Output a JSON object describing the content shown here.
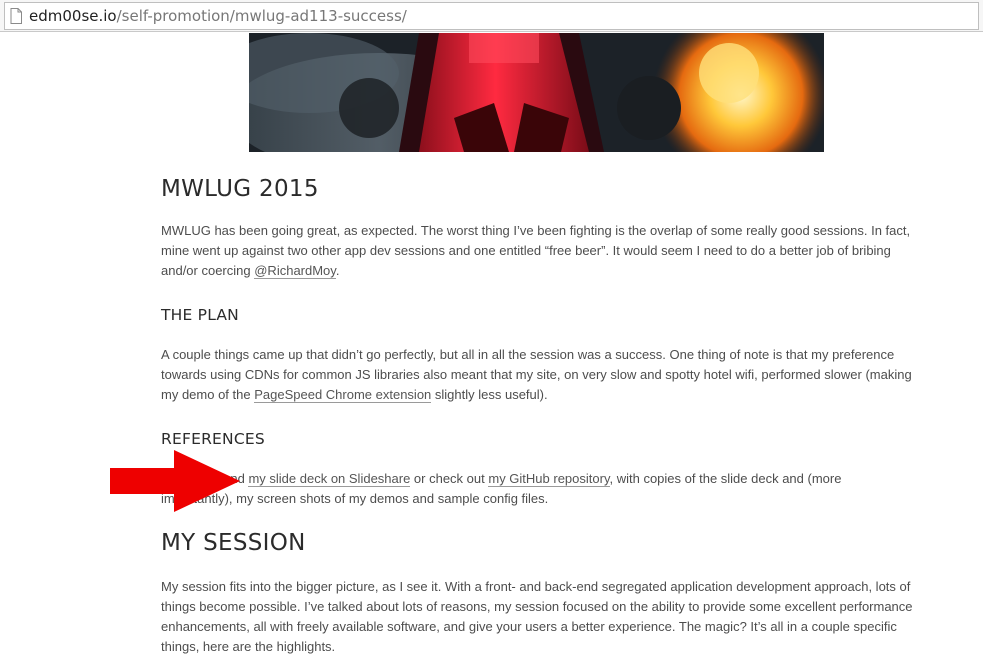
{
  "browser": {
    "url_host": "edm00se.io",
    "url_path": "/self-promotion/mwlug-ad113-success/"
  },
  "article": {
    "heading_1": "MWLUG 2015",
    "para_1_text": "MWLUG has been going great, as expected. The worst thing I’ve been fighting is the overlap of some really good sessions. In fact, mine went up against two other app dev sessions and one entitled “free beer”. It would seem I need to do a better job of bribing and/or coercing ",
    "para_1_link": "@RichardMoy",
    "para_1_end": ".",
    "heading_2": "THE PLAN",
    "para_2_text": "A couple things came up that didn’t go perfectly, but all in all the session was a success. One thing of note is that my preference towards using CDNs for common JS libraries also meant that my site, on very slow and spotty hotel wifi, performed slower (making my demo of the ",
    "para_2_link": "PageSpeed Chrome extension",
    "para_2_end": " slightly less useful).",
    "heading_3": "REFERENCES",
    "para_3_start": "Check out and ",
    "para_3_link_1": "my slide deck on Slideshare",
    "para_3_mid": " or check out ",
    "para_3_link_2": "my GitHub repository",
    "para_3_end": ", with copies of the slide deck and (more importantly), my screen shots of my demos and sample config files.",
    "heading_4": "MY SESSION",
    "para_4_text": "My session fits into the bigger picture, as I see it. With a front- and back-end segregated application development approach, lots of things become possible. I’ve talked about lots of reasons, my session focused on the ability to provide some excellent performance enhancements, all with freely available software, and give your users a better experience. The magic? It’s all in a couple specific things, here are the highlights."
  },
  "colors": {
    "arrow": "#ee0000",
    "text": "#4d4d4d",
    "heading": "#2b2b2b"
  },
  "icons": {
    "address_bar": "page-icon"
  }
}
